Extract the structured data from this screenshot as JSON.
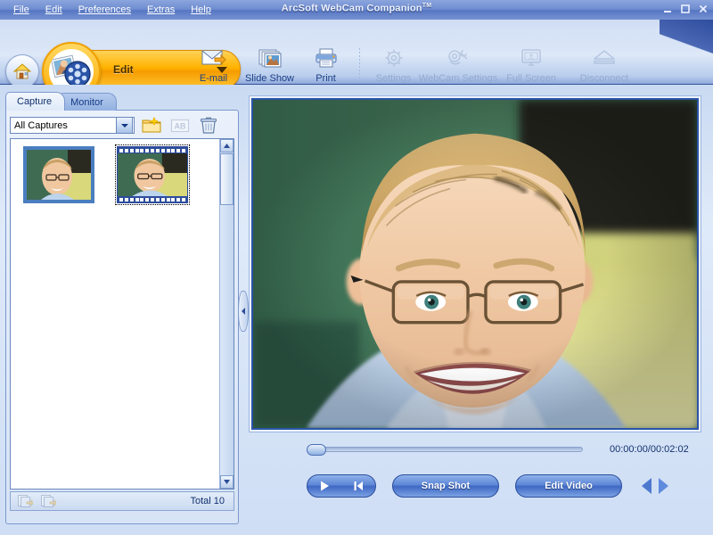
{
  "window": {
    "title": "ArcSoft WebCam Companion",
    "title_tm": "TM",
    "buttons": {
      "minimize": "–",
      "maximize": "□",
      "close": "✕"
    }
  },
  "menubar": {
    "items": [
      {
        "label": "File",
        "accel": "F"
      },
      {
        "label": "Edit",
        "accel": "E"
      },
      {
        "label": "Preferences",
        "accel": "P"
      },
      {
        "label": "Extras",
        "accel": "x"
      },
      {
        "label": "Help",
        "accel": "H"
      }
    ]
  },
  "toolbar": {
    "home_label": "Home",
    "mode": {
      "label": "Edit",
      "icon": "photo-filmreel-icon"
    },
    "tools": [
      {
        "label": "E-mail",
        "icon": "email-icon",
        "enabled": true
      },
      {
        "label": "Slide Show",
        "icon": "slideshow-icon",
        "enabled": true
      },
      {
        "label": "Print",
        "icon": "printer-icon",
        "enabled": true
      },
      {
        "label": "Settings",
        "icon": "gear-icon",
        "enabled": false
      },
      {
        "label": "WebCam Settings",
        "icon": "webcam-gear-icon",
        "enabled": false
      },
      {
        "label": "Full Screen",
        "icon": "monitor-icon",
        "enabled": false
      },
      {
        "label": "Disconnect",
        "icon": "eject-icon",
        "enabled": false
      }
    ]
  },
  "left_panel": {
    "tabs": [
      {
        "label": "Capture",
        "active": true
      },
      {
        "label": "Monitor",
        "active": false
      }
    ],
    "filter": {
      "selected": "All Captures",
      "options": [
        "All Captures"
      ]
    },
    "actions": [
      {
        "name": "new-folder",
        "icon": "new-folder-icon",
        "enabled": true
      },
      {
        "name": "rename",
        "icon": "rename-ab-icon",
        "enabled": false
      },
      {
        "name": "delete",
        "icon": "trash-icon",
        "enabled": true
      }
    ],
    "thumbnails": [
      {
        "type": "photo",
        "selected": false
      },
      {
        "type": "video",
        "selected": true
      }
    ],
    "footer": {
      "buttons": [
        {
          "name": "copy-to",
          "icon": "copy-to-icon",
          "enabled": false
        },
        {
          "name": "move-to",
          "icon": "move-to-icon",
          "enabled": false
        }
      ],
      "total_label": "Total 10"
    }
  },
  "splitter": {
    "collapse_icon": "chevron-left-icon"
  },
  "preview": {
    "media_alt": "man-with-glasses-photo"
  },
  "timeline": {
    "position_percent": 0,
    "timecode": "00:00:00/00:02:02",
    "current_time": "00:00:00",
    "total_time": "00:02:02"
  },
  "transport": {
    "play_icon": "play-icon",
    "prev_icon": "skip-previous-icon",
    "snap_shot_label": "Snap Shot",
    "edit_video_label": "Edit Video",
    "nav_prev_icon": "triangle-left-icon",
    "nav_next_icon": "triangle-right-icon"
  },
  "colors": {
    "title_blue": "#5676c2",
    "accent_orange": "#ffb300",
    "link_blue": "#1b3f86",
    "disabled_gray": "#93a9cf",
    "button_blue": "#3e68c4"
  }
}
